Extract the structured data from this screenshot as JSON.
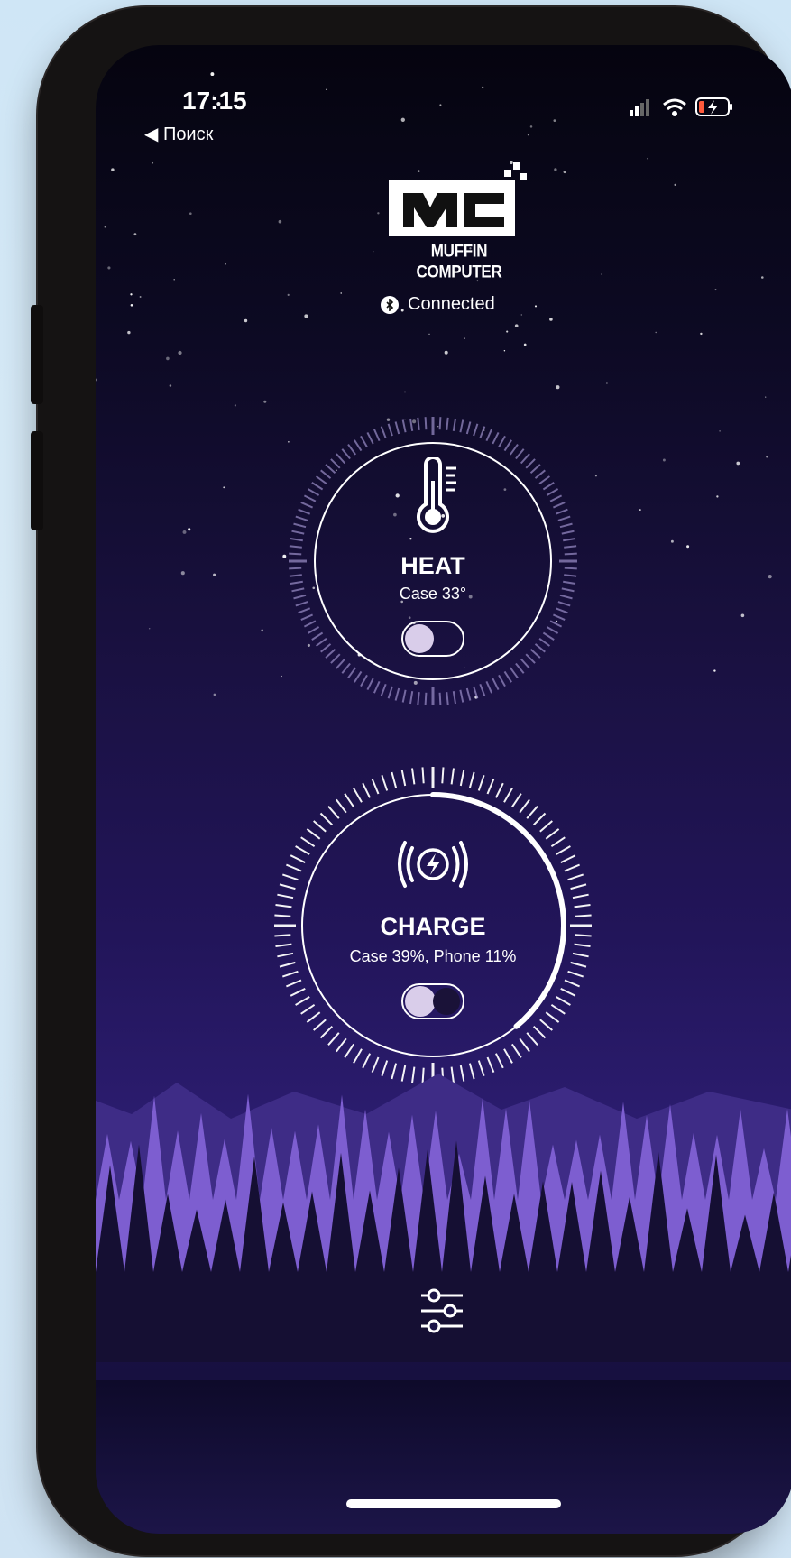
{
  "status_bar": {
    "time": "17:15",
    "back_label": "◀ Поиск"
  },
  "brand": {
    "logo_letters": "MC",
    "name": "MUFFIN COMPUTER"
  },
  "connection": {
    "status": "Connected"
  },
  "heat": {
    "title": "HEAT",
    "subtitle": "Case 33°",
    "enabled": false
  },
  "charge": {
    "title": "CHARGE",
    "subtitle": "Case 39%, Phone 11%",
    "enabled": true,
    "progress": 0.39
  },
  "colors": {
    "accent": "#d9cdea",
    "background_top": "#05040f",
    "background_mid": "#22155a",
    "mountain_far": "#5b3fb3",
    "trees": "#8b6bd9"
  },
  "icons": {
    "heat": "thermometer-icon",
    "charge": "wireless-charge-icon",
    "settings": "sliders-icon",
    "bluetooth": "bluetooth-icon",
    "signal": "signal-icon",
    "wifi": "wifi-icon",
    "battery": "battery-charging-icon"
  }
}
